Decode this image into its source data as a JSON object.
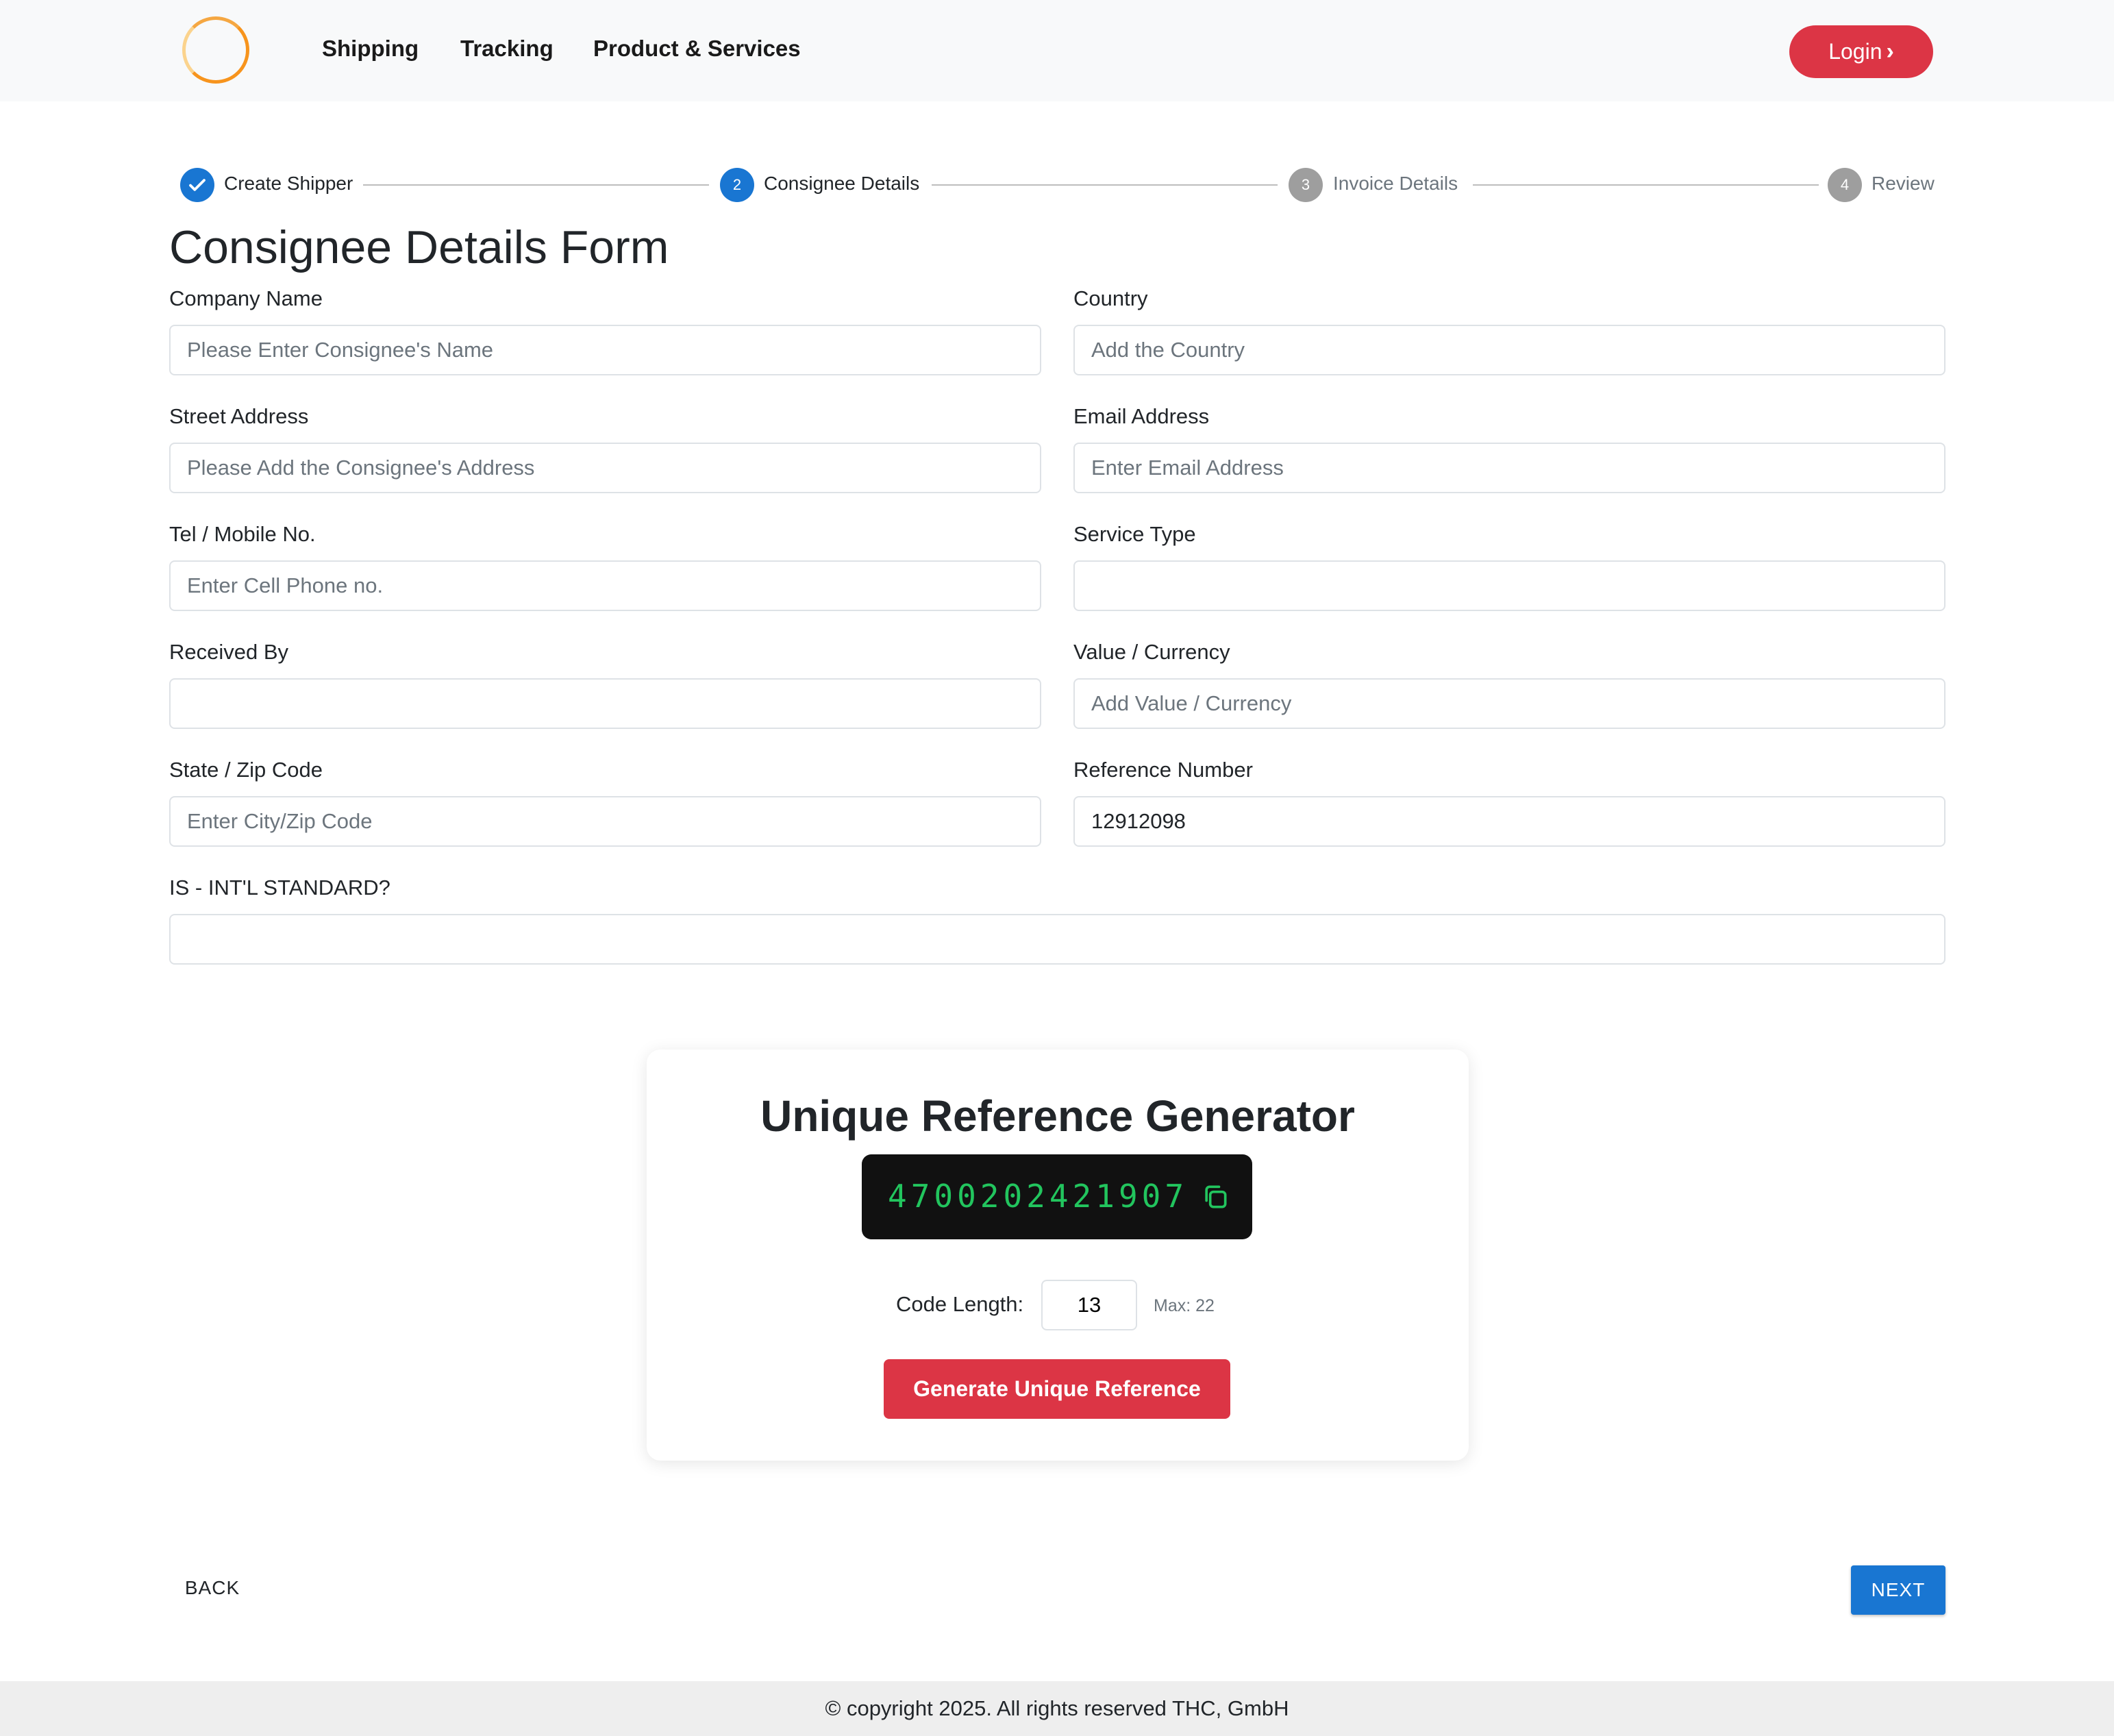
{
  "header": {
    "nav": [
      "Shipping",
      "Tracking",
      "Product & Services"
    ],
    "login_label": "Login"
  },
  "stepper": {
    "steps": [
      {
        "number": "1",
        "label": "Create Shipper",
        "state": "completed"
      },
      {
        "number": "2",
        "label": "Consignee Details",
        "state": "active"
      },
      {
        "number": "3",
        "label": "Invoice Details",
        "state": "pending"
      },
      {
        "number": "4",
        "label": "Review",
        "state": "pending"
      }
    ]
  },
  "form": {
    "title": "Consignee Details Form",
    "fields": {
      "company_name": {
        "label": "Company Name",
        "placeholder": "Please Enter Consignee's Name",
        "value": ""
      },
      "country": {
        "label": "Country",
        "placeholder": "Add the Country",
        "value": ""
      },
      "street_address": {
        "label": "Street Address",
        "placeholder": "Please Add the Consignee's Address",
        "value": ""
      },
      "email_address": {
        "label": "Email Address",
        "placeholder": "Enter Email Address",
        "value": ""
      },
      "tel_mobile": {
        "label": "Tel / Mobile No.",
        "placeholder": "Enter Cell Phone no.",
        "value": ""
      },
      "service_type": {
        "label": "Service Type",
        "placeholder": "",
        "value": ""
      },
      "received_by": {
        "label": "Received By",
        "placeholder": "",
        "value": ""
      },
      "value_currency": {
        "label": "Value / Currency",
        "placeholder": "Add Value / Currency",
        "value": ""
      },
      "state_zip": {
        "label": "State / Zip Code",
        "placeholder": "Enter City/Zip Code",
        "value": ""
      },
      "reference_number": {
        "label": "Reference Number",
        "placeholder": "",
        "value": "12912098"
      },
      "intl_standard": {
        "label": "IS - INT'L STANDARD?",
        "placeholder": "",
        "value": ""
      }
    }
  },
  "generator": {
    "title": "Unique Reference Generator",
    "code": "4700202421907",
    "length_label": "Code Length:",
    "length_value": "13",
    "max_label": "Max: 22",
    "button_label": "Generate Unique Reference"
  },
  "actions": {
    "back_label": "BACK",
    "next_label": "NEXT"
  },
  "footer": {
    "text": "© copyright 2025. All rights reserved THC, GmbH"
  },
  "colors": {
    "brand_red": "#dc3545",
    "primary_blue": "#1976d2",
    "step_pending": "#9e9e9e",
    "code_green": "#22c55e",
    "logo_orange": "#f7941d"
  }
}
